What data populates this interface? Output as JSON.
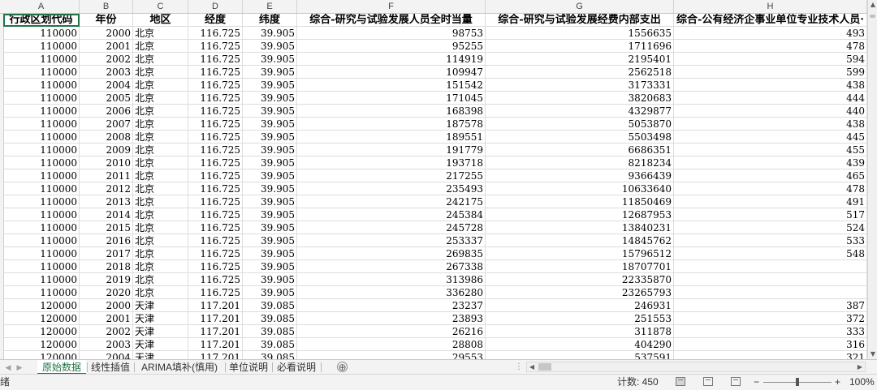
{
  "columns": [
    "A",
    "B",
    "C",
    "D",
    "E",
    "F",
    "G",
    "H"
  ],
  "header_row": [
    "行政区划代码",
    "年份",
    "地区",
    "经度",
    "纬度",
    "综合-研究与试验发展人员全时当量",
    "综合-研究与试验发展经费内部支出",
    "综合-公有经济企事业单位专业技术人员·"
  ],
  "rows": [
    [
      "110000",
      "2000",
      "北京",
      "116.725",
      "39.905",
      "98753",
      "1556635",
      "493"
    ],
    [
      "110000",
      "2001",
      "北京",
      "116.725",
      "39.905",
      "95255",
      "1711696",
      "478"
    ],
    [
      "110000",
      "2002",
      "北京",
      "116.725",
      "39.905",
      "114919",
      "2195401",
      "594"
    ],
    [
      "110000",
      "2003",
      "北京",
      "116.725",
      "39.905",
      "109947",
      "2562518",
      "599"
    ],
    [
      "110000",
      "2004",
      "北京",
      "116.725",
      "39.905",
      "151542",
      "3173331",
      "438"
    ],
    [
      "110000",
      "2005",
      "北京",
      "116.725",
      "39.905",
      "171045",
      "3820683",
      "444"
    ],
    [
      "110000",
      "2006",
      "北京",
      "116.725",
      "39.905",
      "168398",
      "4329877",
      "440"
    ],
    [
      "110000",
      "2007",
      "北京",
      "116.725",
      "39.905",
      "187578",
      "5053870",
      "438"
    ],
    [
      "110000",
      "2008",
      "北京",
      "116.725",
      "39.905",
      "189551",
      "5503498",
      "445"
    ],
    [
      "110000",
      "2009",
      "北京",
      "116.725",
      "39.905",
      "191779",
      "6686351",
      "455"
    ],
    [
      "110000",
      "2010",
      "北京",
      "116.725",
      "39.905",
      "193718",
      "8218234",
      "439"
    ],
    [
      "110000",
      "2011",
      "北京",
      "116.725",
      "39.905",
      "217255",
      "9366439",
      "465"
    ],
    [
      "110000",
      "2012",
      "北京",
      "116.725",
      "39.905",
      "235493",
      "10633640",
      "478"
    ],
    [
      "110000",
      "2013",
      "北京",
      "116.725",
      "39.905",
      "242175",
      "11850469",
      "491"
    ],
    [
      "110000",
      "2014",
      "北京",
      "116.725",
      "39.905",
      "245384",
      "12687953",
      "517"
    ],
    [
      "110000",
      "2015",
      "北京",
      "116.725",
      "39.905",
      "245728",
      "13840231",
      "524"
    ],
    [
      "110000",
      "2016",
      "北京",
      "116.725",
      "39.905",
      "253337",
      "14845762",
      "533"
    ],
    [
      "110000",
      "2017",
      "北京",
      "116.725",
      "39.905",
      "269835",
      "15796512",
      "548"
    ],
    [
      "110000",
      "2018",
      "北京",
      "116.725",
      "39.905",
      "267338",
      "18707701",
      ""
    ],
    [
      "110000",
      "2019",
      "北京",
      "116.725",
      "39.905",
      "313986",
      "22335870",
      ""
    ],
    [
      "110000",
      "2020",
      "北京",
      "116.725",
      "39.905",
      "336280",
      "23265793",
      ""
    ],
    [
      "120000",
      "2000",
      "天津",
      "117.201",
      "39.085",
      "23237",
      "246931",
      "387"
    ],
    [
      "120000",
      "2001",
      "天津",
      "117.201",
      "39.085",
      "23893",
      "251553",
      "372"
    ],
    [
      "120000",
      "2002",
      "天津",
      "117.201",
      "39.085",
      "26216",
      "311878",
      "333"
    ],
    [
      "120000",
      "2003",
      "天津",
      "117.201",
      "39.085",
      "28808",
      "404290",
      "316"
    ],
    [
      "120000",
      "2004",
      "天津",
      "117.201",
      "39.085",
      "29553",
      "537591",
      "321"
    ]
  ],
  "sheet_tabs": [
    "原始数据",
    "线性插值",
    "ARIMA填补(慎用)",
    "单位说明",
    "必看说明"
  ],
  "active_tab": "原始数据",
  "tab_nav": {
    "prev": "◀",
    "next": "▶"
  },
  "add_sheet": "⊕",
  "tab_overflow": "⋮",
  "status": {
    "mode": "绪",
    "count": "计数: 450",
    "zoom_minus": "−",
    "zoom_plus": "+",
    "zoom": "100%"
  },
  "scroll_arrows": {
    "up": "▲",
    "down": "▼",
    "left": "◀",
    "right": "▶"
  },
  "colors": {
    "accent": "#217346",
    "grid": "#dcdcdc",
    "header_bg": "#f3f3f3"
  }
}
